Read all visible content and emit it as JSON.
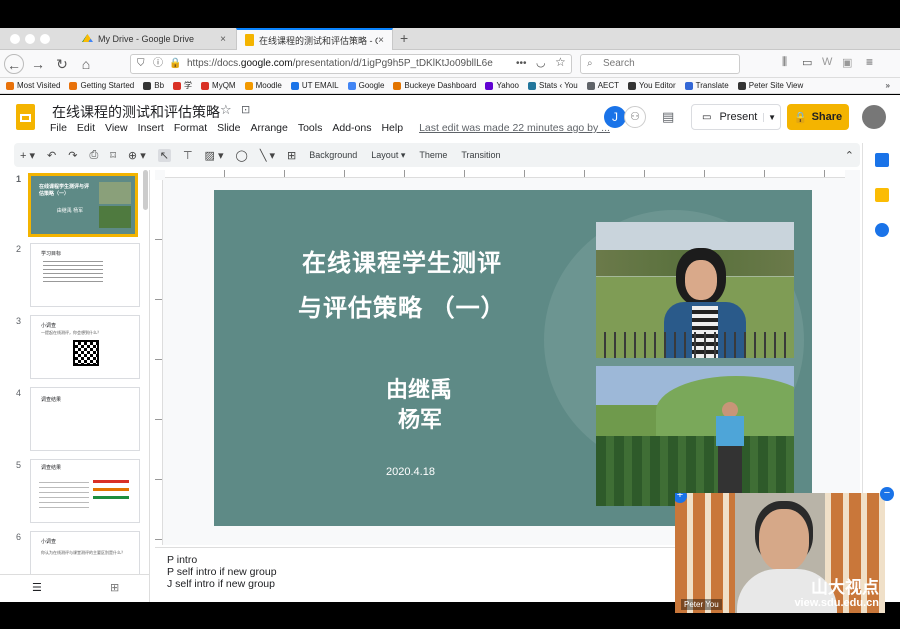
{
  "browser": {
    "tabs": [
      {
        "label": "My Drive - Google Drive",
        "close": "×"
      },
      {
        "label": "在线课程的测试和评估策略 - Goo",
        "close": "×"
      }
    ],
    "new_tab": "+",
    "url_host": "https://docs.",
    "url_domain": "google.com",
    "url_path": "/presentation/d/1igPg9h5P_tDKlKtJo09bllL6e",
    "url_dots": "•••",
    "search_placeholder": "Search",
    "bookmarks": [
      "Most Visited",
      "Getting Started",
      "Bb",
      "学",
      "MyQM",
      "Moodle",
      "UT EMAIL",
      "Google",
      "Buckeye Dashboard",
      "Yahoo",
      "Stats ‹ You",
      "AECT",
      "You Editor",
      "Translate",
      "Peter Site View"
    ],
    "bookmark_colors": [
      "#e8710a",
      "#e8710a",
      "#333333",
      "#d93025",
      "#d93025",
      "#f29900",
      "#1a73e8",
      "#4285f4",
      "#e37400",
      "#6001d2",
      "#21759b",
      "#5f6368",
      "#333333",
      "#3367d6",
      "#333333"
    ]
  },
  "doc": {
    "title": "在线课程的测试和评估策略",
    "menu": [
      "File",
      "Edit",
      "View",
      "Insert",
      "Format",
      "Slide",
      "Arrange",
      "Tools",
      "Add-ons",
      "Help"
    ],
    "last_edit": "Last edit was made 22 minutes ago by ...",
    "avatar_letter": "J",
    "present_label": "Present",
    "share_label": "Share"
  },
  "toolbar": {
    "background": "Background",
    "layout": "Layout",
    "theme": "Theme",
    "transition": "Transition"
  },
  "filmstrip": {
    "numbers": [
      "1",
      "2",
      "3",
      "4",
      "5",
      "6"
    ],
    "slide1_title": "在线课程学生测评与评估策略（一）",
    "slide1_authors": "由继禹 杨军",
    "slide2_title": "学习目标",
    "slide3_title": "小调查",
    "slide3_sub": "一提起在线测评，你会想到什么？",
    "slide4_title": "调查结果",
    "slide5_title": "调查结果",
    "slide6_title": "小调查",
    "slide6_sub": "你认为在线测评与课堂测评的主要区别是什么？"
  },
  "slide": {
    "title_line1": "在线课程学生测评",
    "title_line2": "与评估策略 （一）",
    "author1": "由继禹",
    "author2": "杨军",
    "date": "2020.4.18"
  },
  "notes": [
    "P intro",
    "P self intro if new group",
    "J self intro if new group"
  ],
  "video": {
    "name": "Peter You",
    "watermark_cn": "山大视点",
    "watermark_url": "view.sdu.edu.cn"
  },
  "colors": {
    "accent": "#f4b400",
    "slide_bg": "#5e8a86",
    "link": "#1a73e8"
  }
}
